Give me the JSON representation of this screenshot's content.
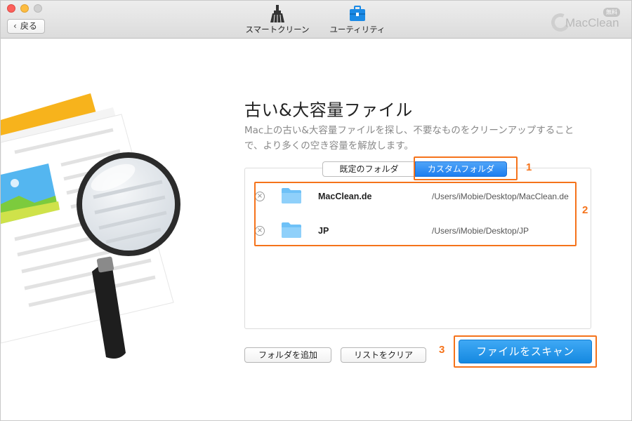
{
  "toolbar": {
    "back_label": "戻る",
    "tools": [
      {
        "label": "スマートクリーン",
        "icon": "broom-icon"
      },
      {
        "label": "ユーティリティ",
        "icon": "toolbox-icon"
      }
    ],
    "brand": "MacClean",
    "brand_badge": "無料"
  },
  "main": {
    "title": "古い&大容量ファイル",
    "description": "Mac上の古い&大容量ファイルを探し、不要なものをクリーンアップすることで、より多くの空き容量を解放します。",
    "tabs": [
      {
        "label": "既定のフォルダ",
        "selected": false
      },
      {
        "label": "カスタムフォルダ",
        "selected": true
      }
    ],
    "folders": [
      {
        "name": "MacClean.de",
        "path": "/Users/iMobie/Desktop/MacClean.de"
      },
      {
        "name": "JP",
        "path": "/Users/iMobie/Desktop/JP"
      }
    ],
    "add_folder_label": "フォルダを追加",
    "clear_list_label": "リストをクリア",
    "scan_label": "ファイルをスキャン"
  },
  "annotations": [
    "1",
    "2",
    "3"
  ],
  "colors": {
    "accent": "#1c7ef0",
    "highlight": "#f5731b"
  }
}
